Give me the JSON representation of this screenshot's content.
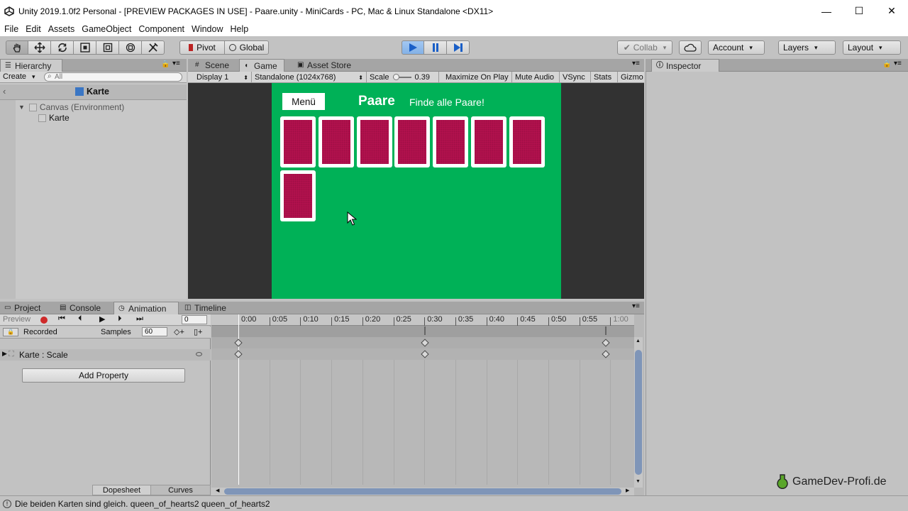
{
  "window": {
    "title": "Unity 2019.1.0f2 Personal - [PREVIEW PACKAGES IN USE] - Paare.unity - MiniCards - PC, Mac & Linux Standalone <DX11>",
    "minimize": "—",
    "maximize": "☐",
    "close": "✕"
  },
  "menu": [
    "File",
    "Edit",
    "Assets",
    "GameObject",
    "Component",
    "Window",
    "Help"
  ],
  "toolbar": {
    "pivot": "Pivot",
    "global": "Global",
    "collab": "Collab",
    "account": "Account",
    "layers": "Layers",
    "layout": "Layout"
  },
  "hierarchy": {
    "tab": "Hierarchy",
    "create": "Create",
    "search_placeholder": "All",
    "scene_title": "Karte",
    "items": [
      "Canvas (Environment)",
      "Karte"
    ]
  },
  "game_tabs": [
    "Scene",
    "Game",
    "Asset Store"
  ],
  "game_bar": {
    "display": "Display 1",
    "resolution": "Standalone (1024x768)",
    "scale_label": "Scale",
    "scale_value": "0.39",
    "maximize": "Maximize On Play",
    "mute": "Mute Audio",
    "vsync": "VSync",
    "stats": "Stats",
    "gizmos": "Gizmo"
  },
  "game": {
    "menu_button": "Menü",
    "title": "Paare",
    "subtitle": "Finde alle Paare!",
    "card_count": 8,
    "bg_color": "#00b157",
    "card_color": "#b5124f"
  },
  "inspector": {
    "tab": "Inspector"
  },
  "bottom_tabs": [
    "Project",
    "Console",
    "Animation",
    "Timeline"
  ],
  "animation": {
    "preview": "Preview",
    "frame": "0",
    "recorded": "Recorded",
    "samples_label": "Samples",
    "samples_value": "60",
    "property": "Karte : Scale",
    "add_property": "Add Property",
    "dopesheet": "Dopesheet",
    "curves": "Curves",
    "ruler": [
      "0:00",
      "0:05",
      "0:10",
      "0:15",
      "0:20",
      "0:25",
      "0:30",
      "0:35",
      "0:40",
      "0:45",
      "0:50",
      "0:55",
      "1:00"
    ]
  },
  "status": {
    "message": "Die beiden Karten sind gleich. queen_of_hearts2 queen_of_hearts2"
  },
  "watermark": "GameDev-Profi.de"
}
